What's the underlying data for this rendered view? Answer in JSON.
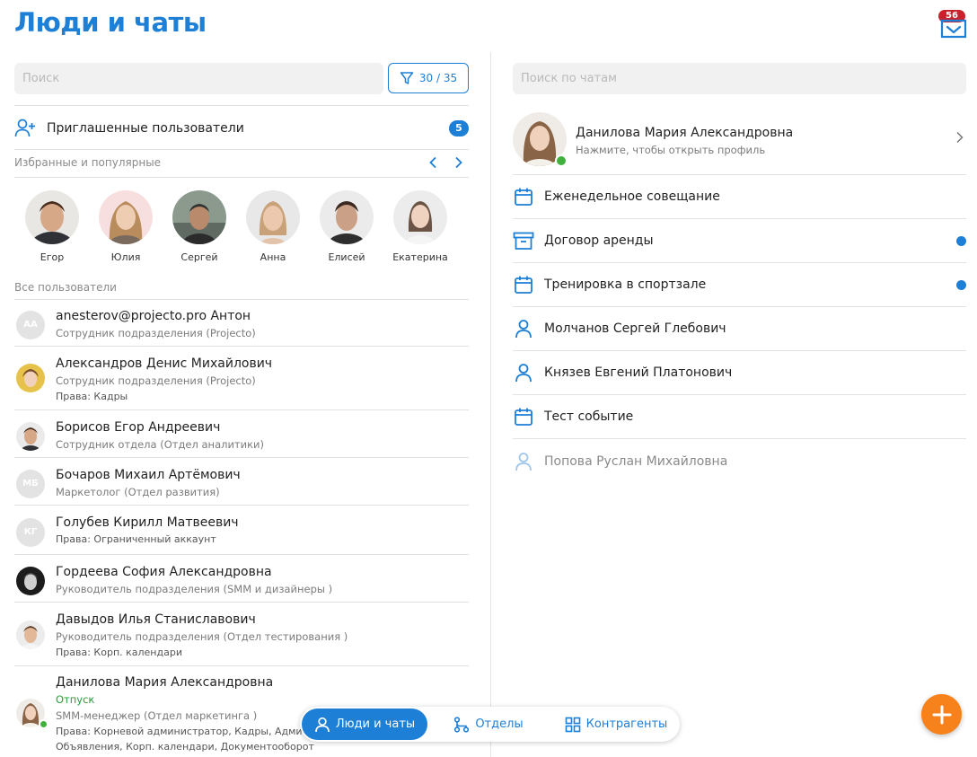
{
  "header": {
    "title": "Люди и чаты",
    "inbox_badge": "56"
  },
  "people_panel": {
    "search_placeholder": "Поиск",
    "filter_label": "30 / 35",
    "invited": {
      "label": "Приглашенные пользователи",
      "count": "5"
    },
    "favorites_label": "Избранные и популярные",
    "favorites": [
      {
        "name": "Егор",
        "icon": "avatar-photo"
      },
      {
        "name": "Юлия",
        "icon": "avatar-photo"
      },
      {
        "name": "Сергей",
        "icon": "avatar-photo"
      },
      {
        "name": "Анна",
        "icon": "avatar-photo"
      },
      {
        "name": "Елисей",
        "icon": "avatar-photo"
      },
      {
        "name": "Екатерина",
        "icon": "avatar-photo"
      }
    ],
    "all_users_label": "Все пользователи",
    "users": [
      {
        "initials": "AA",
        "name": "anesterov@projecto.pro Антон",
        "position": "Сотрудник подразделения (Projecto)"
      },
      {
        "name": "Александров Денис Михайлович",
        "position": "Сотрудник подразделения (Projecto)",
        "rights": "Права: Кадры"
      },
      {
        "name": "Борисов Егор Андреевич",
        "position": "Сотрудник отдела (Отдел аналитики)"
      },
      {
        "initials": "МБ",
        "name": "Бочаров Михаил Артёмович",
        "position": "Маркетолог (Отдел развития)"
      },
      {
        "initials": "КГ",
        "name": "Голубев Кирилл Матвеевич",
        "rights": "Права: Ограниченный аккаунт"
      },
      {
        "name": "Гордеева София Александровна",
        "position": "Руководитель подразделения (SMM и дизайнеры )"
      },
      {
        "name": "Давыдов Илья Станиславович",
        "position": "Руководитель подразделения (Отдел тестирования )",
        "rights": "Права: Корп. календари"
      },
      {
        "name": "Данилова Мария Александровна",
        "status": "Отпуск",
        "position": "SMM-менеджер (Отдел маркетинга )",
        "rights": "Права: Корневой администратор, Кадры, Админи",
        "rights2": "Объявления, Корп. календари, Документооборот"
      }
    ]
  },
  "chats_panel": {
    "search_placeholder": "Поиск по чатам",
    "profile": {
      "name": "Данилова Мария Александровна",
      "hint": "Нажмите, чтобы открыть профиль"
    },
    "chats": [
      {
        "label": "Еженедельное совещание",
        "icon": "calendar-icon",
        "unread": false,
        "muted": false
      },
      {
        "label": "Договор аренды",
        "icon": "archive-icon",
        "unread": true,
        "muted": false
      },
      {
        "label": "Тренировка в спортзале",
        "icon": "calendar-icon",
        "unread": true,
        "muted": false
      },
      {
        "label": "Молчанов Сергей Глебович",
        "icon": "person-icon",
        "unread": false,
        "muted": false
      },
      {
        "label": "Князев Евгений Платонович",
        "icon": "person-icon",
        "unread": false,
        "muted": false
      },
      {
        "label": "Тест событие",
        "icon": "calendar-icon",
        "unread": false,
        "muted": false
      },
      {
        "label": "Попова Руслан Михайловна",
        "icon": "person-icon",
        "unread": false,
        "muted": true
      }
    ]
  },
  "bottom_nav": {
    "tabs": [
      {
        "label": "Люди и чаты",
        "icon": "person-icon",
        "active": true
      },
      {
        "label": "Отделы",
        "icon": "org-structure-icon",
        "active": false
      },
      {
        "label": "Контрагенты",
        "icon": "grid-icon",
        "active": false
      }
    ]
  },
  "fab": {
    "icon": "plus-icon"
  },
  "colors": {
    "accent": "#1d7fd6",
    "badge": "#c8232c",
    "online": "#3fb13c",
    "fab": "#f7821b",
    "status_vacation": "#2e9a3a"
  }
}
